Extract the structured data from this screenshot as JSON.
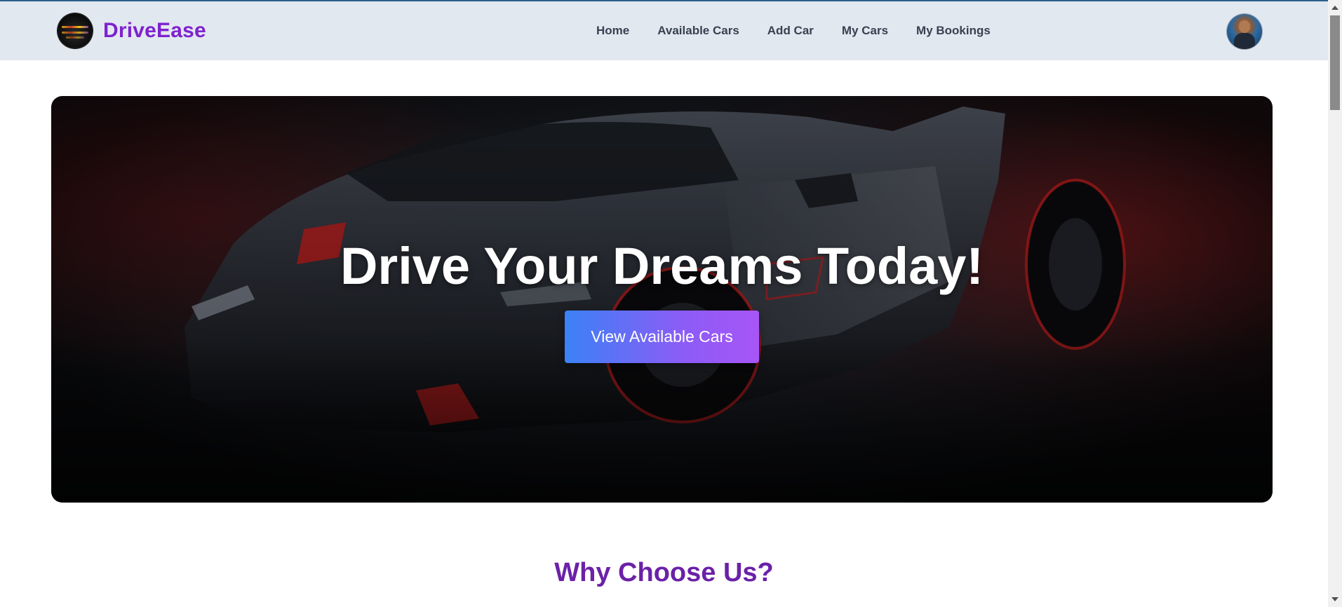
{
  "brand": {
    "name": "DriveEase",
    "color": "#7e22ce"
  },
  "nav": {
    "items": [
      {
        "label": "Home"
      },
      {
        "label": "Available Cars"
      },
      {
        "label": "Add Car"
      },
      {
        "label": "My Cars"
      },
      {
        "label": "My Bookings"
      }
    ]
  },
  "hero": {
    "title": "Drive Your Dreams Today!",
    "button_label": "View Available Cars",
    "button_gradient": [
      "#3b82f6",
      "#a855f7"
    ]
  },
  "sections": {
    "why_choose_us": "Why Choose Us?"
  },
  "icons": {
    "brand_logo": "brand-logo-icon",
    "user_avatar": "user-avatar-icon"
  }
}
